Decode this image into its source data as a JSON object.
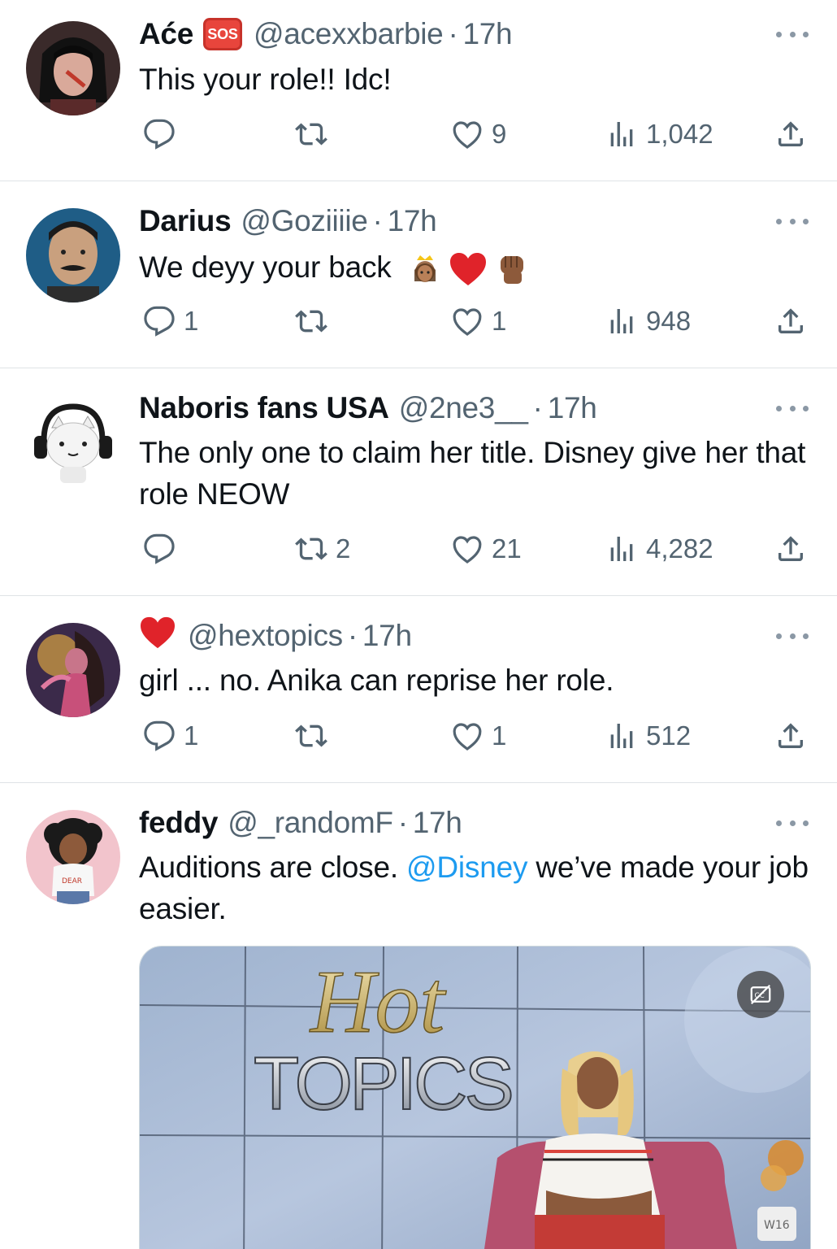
{
  "tweets": [
    {
      "name": "Aće",
      "badge": "SOS",
      "handle": "@acexxbarbie",
      "dot": "·",
      "time": "17h",
      "text": "This your role!! Idc!",
      "replies": "",
      "retweets": "",
      "likes": "9",
      "views": "1,042"
    },
    {
      "name": "Darius",
      "handle": "@Goziiiie",
      "dot": "·",
      "time": "17h",
      "text": "We deyy your back",
      "replies": "1",
      "retweets": "",
      "likes": "1",
      "views": "948"
    },
    {
      "name": "Naboris fans USA",
      "handle": "@2ne3__",
      "dot": "·",
      "time": "17h",
      "text": "The only one to claim her title. Disney give her that role NEOW",
      "replies": "",
      "retweets": "2",
      "likes": "21",
      "views": "4,282"
    },
    {
      "name": "",
      "handle": "@hextopics",
      "dot": "·",
      "time": "17h",
      "text": "girl ... no. Anika can reprise her role.",
      "replies": "1",
      "retweets": "",
      "likes": "1",
      "views": "512"
    },
    {
      "name": "feddy",
      "handle": "@_randomF",
      "dot": "·",
      "time": "17h",
      "text_before": "Auditions are close.",
      "mention": "@Disney",
      "text_after": "we’ve made your job easier."
    }
  ],
  "media": {
    "title_line1": "Hot",
    "title_line2": "TOPICS",
    "watermark": "W16"
  },
  "colors": {
    "text": "#0f1419",
    "secondary": "#536471",
    "link": "#1d9bf0",
    "divider": "#dfe3e6"
  },
  "icons": [
    "reply-icon",
    "retweet-icon",
    "like-icon",
    "views-icon",
    "share-icon",
    "more-icon",
    "captions-icon"
  ]
}
